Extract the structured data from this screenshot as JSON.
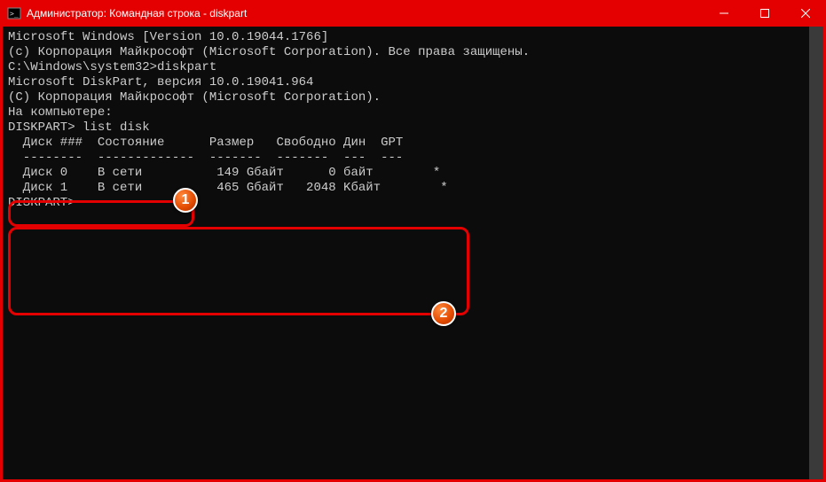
{
  "titlebar": {
    "title": "Администратор: Командная строка - diskpart"
  },
  "terminal": {
    "lines": [
      "Microsoft Windows [Version 10.0.19044.1766]",
      "(c) Корпорация Майкрософт (Microsoft Corporation). Все права защищены.",
      "",
      "C:\\Windows\\system32>diskpart",
      "",
      "Microsoft DiskPart, версия 10.0.19041.964",
      "",
      "(C) Корпорация Майкрософт (Microsoft Corporation).",
      "На компьютере:",
      "",
      "DISKPART> list disk",
      "",
      "  Диск ###  Состояние      Размер   Свободно Дин  GPT",
      "  --------  -------------  -------  -------  ---  ---",
      "  Диск 0    В сети          149 Gбайт      0 байт        *",
      "  Диск 1    В сети          465 Gбайт   2048 Kбайт        *",
      "",
      "DISKPART>"
    ]
  },
  "annotations": {
    "badge1": "1",
    "badge2": "2"
  }
}
